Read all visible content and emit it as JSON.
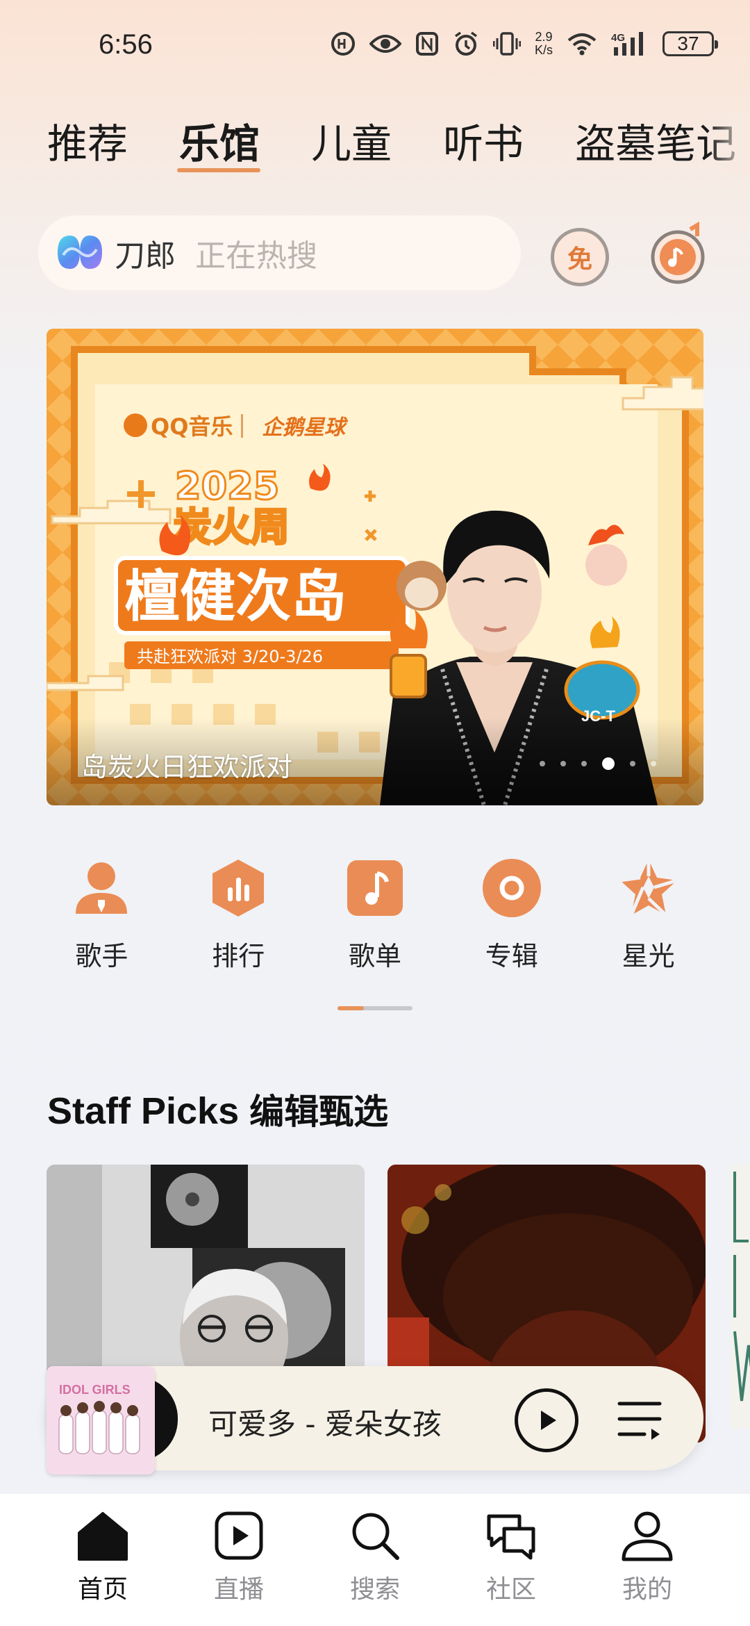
{
  "status_bar": {
    "time": "6:56",
    "net_speed_value": "2.9",
    "net_speed_unit": "K/s",
    "battery": "37",
    "icons": [
      "hd-icon",
      "eye-icon",
      "nfc-icon",
      "alarm-icon",
      "vibrate-icon",
      "wifi-icon",
      "signal-4g-icon",
      "battery-icon"
    ]
  },
  "top_tabs": [
    "推荐",
    "乐馆",
    "儿童",
    "听书",
    "盗墓笔记"
  ],
  "active_tab": "乐馆",
  "search": {
    "keyword": "刀郎",
    "hint": "正在热搜",
    "free_label": "免"
  },
  "banner": {
    "brand_left": "QQ音乐",
    "brand_right": "企鹅星球",
    "year": "2025",
    "event": "炭火周",
    "headline": "檀健次岛",
    "dates": "共赴狂欢派对 3/20-3/26",
    "caption": "岛炭火日狂欢派对",
    "mascot_tag": "JC-T",
    "dot_count": 7,
    "active_dot": 4
  },
  "categories": [
    {
      "label": "歌手",
      "icon": "singer-icon"
    },
    {
      "label": "排行",
      "icon": "ranking-icon"
    },
    {
      "label": "歌单",
      "icon": "playlist-icon"
    },
    {
      "label": "专辑",
      "icon": "album-icon"
    },
    {
      "label": "星光",
      "icon": "starlight-icon"
    }
  ],
  "staff_picks": {
    "title_en": "Staff Picks",
    "title_cn": "编辑甄选"
  },
  "mini_player": {
    "song": "可爱多 - 爱朵女孩",
    "cover_text": "IDOL GIRLS"
  },
  "bottom_nav": [
    {
      "label": "首页",
      "icon": "home-icon",
      "active": true
    },
    {
      "label": "直播",
      "icon": "live-icon",
      "active": false
    },
    {
      "label": "搜索",
      "icon": "search-icon",
      "active": false
    },
    {
      "label": "社区",
      "icon": "community-icon",
      "active": false
    },
    {
      "label": "我的",
      "icon": "profile-icon",
      "active": false
    }
  ],
  "colors": {
    "accent": "#e8935a",
    "icon_orange": "#ea8c55",
    "banner_orange": "#f7a53a"
  }
}
